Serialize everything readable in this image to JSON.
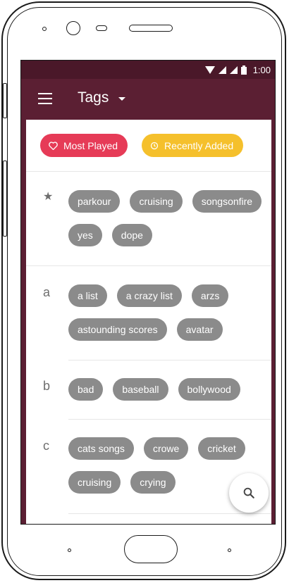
{
  "status_bar": {
    "time": "1:00"
  },
  "toolbar": {
    "title": "Tags"
  },
  "filters": [
    {
      "label": "Most Played",
      "icon": "heart-icon",
      "color": "#e63b57"
    },
    {
      "label": "Recently Added",
      "icon": "clock-icon",
      "color": "#f5c02c"
    }
  ],
  "sections": [
    {
      "header": "★",
      "tags": [
        "parkour",
        "cruising",
        "songsonfire",
        "yes",
        "dope"
      ]
    },
    {
      "header": "a",
      "tags": [
        "a list",
        "a crazy list",
        "arzs",
        "astounding scores",
        "avatar"
      ]
    },
    {
      "header": "b",
      "tags": [
        "bad",
        "baseball",
        "bollywood"
      ]
    },
    {
      "header": "c",
      "tags": [
        "cats songs",
        "crowe",
        "cricket",
        "cruising",
        "crying"
      ]
    }
  ],
  "colors": {
    "primary": "#5b1f33",
    "status_bar": "#4a1829",
    "chip": "#8b8b8b"
  }
}
